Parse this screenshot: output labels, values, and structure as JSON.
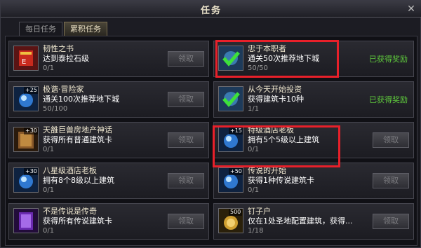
{
  "window": {
    "title": "任务",
    "close_glyph": "✕"
  },
  "tabs": [
    {
      "label": "每日任务",
      "active": false
    },
    {
      "label": "累积任务",
      "active": true
    }
  ],
  "quests": [
    {
      "name": "韧性之书",
      "desc": "达到泰拉石级",
      "progress": "0/1",
      "action": "领取",
      "icon": "red-book-icon"
    },
    {
      "name": "忠于本职者",
      "desc": "通关50次推荐地下城",
      "progress": "50/50",
      "action": "已获得奖励",
      "claimed": true,
      "icon": "checkmark-icon"
    },
    {
      "name": "极谐·冒险家",
      "desc": "通关100次推荐地下城",
      "progress": "50/100",
      "action": "领取",
      "icon": "blue-orb-icon",
      "level": "+25"
    },
    {
      "name": "从今天开始投资",
      "desc": "获得建筑卡10种",
      "progress": "1/1",
      "action": "已获得奖励",
      "claimed": true,
      "icon": "checkmark-icon"
    },
    {
      "name": "天雒巨兽房地产神话",
      "desc": "获得所有普通建筑卡",
      "progress": "0/1",
      "action": "领取",
      "icon": "gold-card-icon",
      "level": "+30"
    },
    {
      "name": "特级酒店老板",
      "desc": "拥有5个5级以上建筑",
      "progress": "0/1",
      "action": "领取",
      "icon": "blue-orb-icon",
      "level": "+15"
    },
    {
      "name": "八星级酒店老板",
      "desc": "拥有8个8级以上建筑",
      "progress": "0/1",
      "action": "领取",
      "icon": "blue-orb-icon",
      "level": "+30"
    },
    {
      "name": "传说的开始",
      "desc": "获得1种传说建筑卡",
      "progress": "0/1",
      "action": "领取",
      "icon": "blue-orb-icon",
      "level": "+50"
    },
    {
      "name": "不是传说是传奇",
      "desc": "获得所有传说建筑卡",
      "progress": "0/1",
      "action": "领取",
      "icon": "purple-card-icon"
    },
    {
      "name": "钉子户",
      "desc": "仅在1处圣地配置建筑，获得...",
      "progress": "1/18",
      "action": "领取",
      "icon": "gold-coin-icon",
      "level": "500"
    }
  ],
  "colors": {
    "claimed": "#5ec83c",
    "highlight": "#e8202a",
    "title": "#e8e0c8"
  }
}
